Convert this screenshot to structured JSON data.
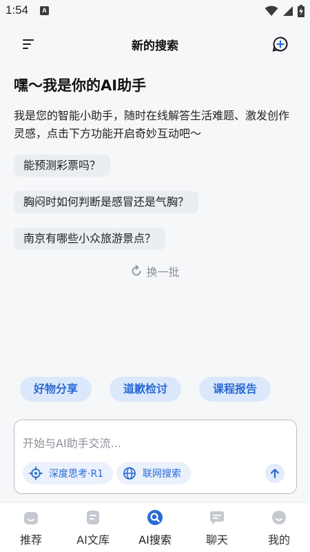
{
  "status_bar": {
    "time": "1:54",
    "notification_letter": "A"
  },
  "header": {
    "title": "新的搜索"
  },
  "greeting": {
    "title": "嘿～我是你的AI助手",
    "text": "我是您的智能小助手，随时在线解答生活难题、激发创作灵感，点击下方功能开启奇妙互动吧～"
  },
  "suggestions": [
    "能预测彩票吗？",
    "胸闷时如何判断是感冒还是气胸？",
    "南京有哪些小众旅游景点？"
  ],
  "refresh_label": "换一批",
  "chips": [
    "好物分享",
    "道歉检讨",
    "课程报告"
  ],
  "composer": {
    "placeholder": "开始与AI助手交流...",
    "tools": [
      "深度思考·R1",
      "联网搜索"
    ]
  },
  "nav": {
    "items": [
      "推荐",
      "AI文库",
      "AI搜索",
      "聊天",
      "我的"
    ],
    "active_index": 2
  },
  "colors": {
    "accent": "#2a6ad4",
    "chip_bg": "#dbe8fb",
    "inactive_icon": "#c4c8cf"
  }
}
